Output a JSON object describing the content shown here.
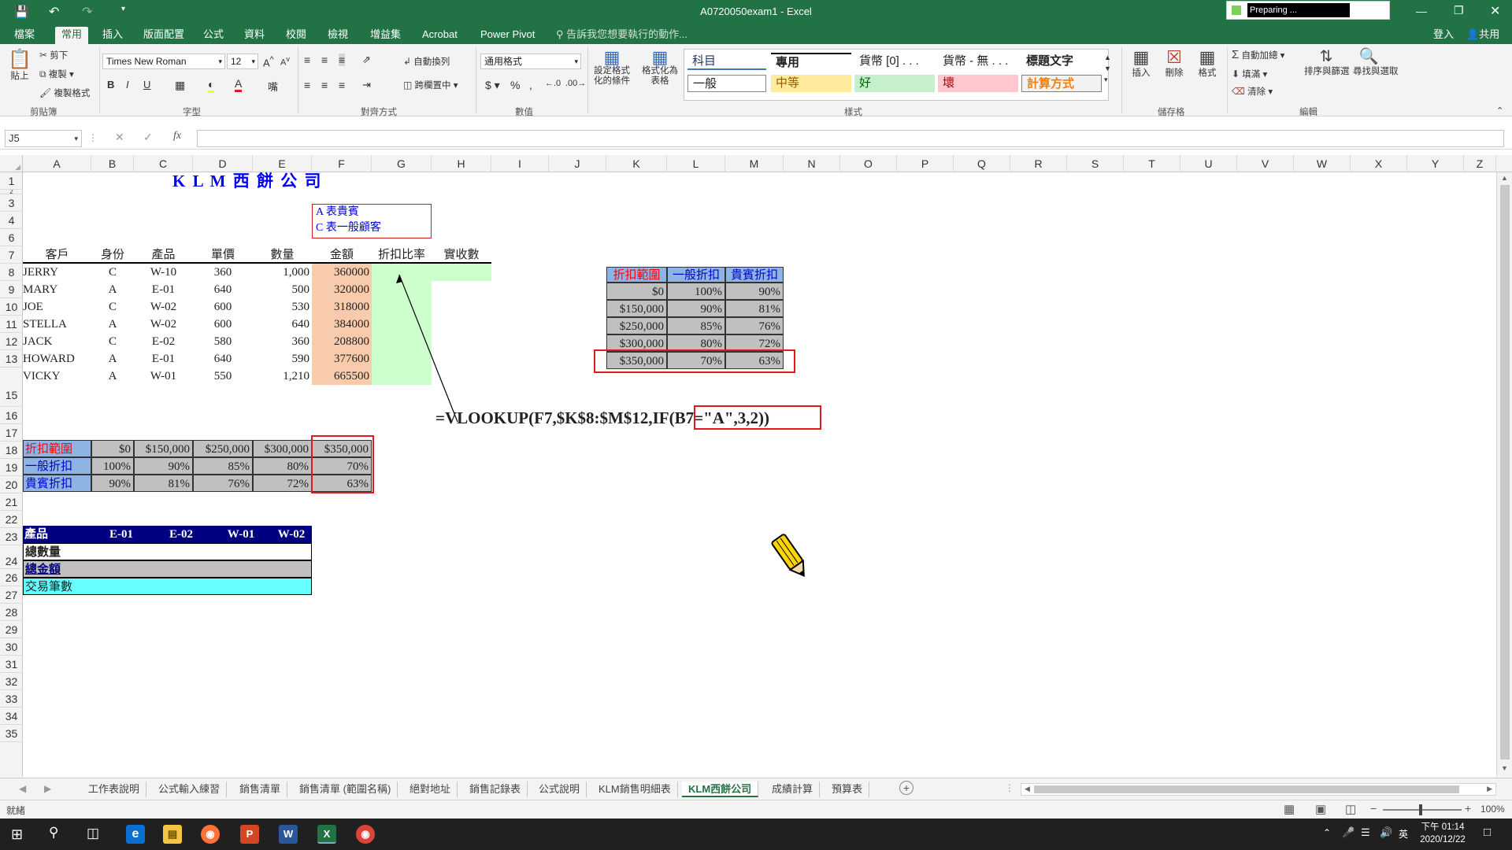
{
  "window": {
    "title": "A0720050exam1 - Excel",
    "progress_label": "Preparing ..."
  },
  "qat": {
    "save_icon": "save-icon",
    "undo_icon": "undo-icon",
    "redo_icon": "redo-icon"
  },
  "ribbon_tabs": [
    "檔案",
    "常用",
    "插入",
    "版面配置",
    "公式",
    "資料",
    "校閱",
    "檢視",
    "增益集",
    "Acrobat",
    "Power Pivot"
  ],
  "tell_me": "告訴我您想要執行的動作...",
  "account": {
    "signin": "登入",
    "share": "共用"
  },
  "clipboard": {
    "paste": "貼上",
    "cut": "剪下",
    "copy": "複製",
    "format_painter": "複製格式",
    "group": "剪貼簿"
  },
  "font": {
    "name": "Times New Roman",
    "size": "12",
    "group": "字型"
  },
  "alignment": {
    "wrap": "自動換列",
    "merge": "跨欄置中",
    "group": "對齊方式"
  },
  "number": {
    "format": "通用格式",
    "group": "數值"
  },
  "styles": {
    "cond_format": "設定格式化的條件",
    "as_table": "格式化為表格",
    "items": [
      "科目",
      "專用",
      "貨幣 [0] . . .",
      "貨幣 - 無 . . .",
      "標題文字",
      "一般",
      "中等",
      "好",
      "壞",
      "計算方式"
    ],
    "group": "樣式"
  },
  "cells_group": {
    "insert": "插入",
    "delete": "刪除",
    "format": "格式",
    "group": "儲存格"
  },
  "editing": {
    "autosum": "自動加總",
    "fill": "填滿",
    "clear": "清除",
    "sort": "排序與篩選",
    "find": "尋找與選取",
    "group": "編輯"
  },
  "formula_bar": {
    "name_box": "J5",
    "formula": ""
  },
  "columns": [
    "A",
    "B",
    "C",
    "D",
    "E",
    "F",
    "G",
    "H",
    "I",
    "J",
    "K",
    "L",
    "M",
    "N",
    "O",
    "P",
    "Q",
    "R",
    "S",
    "T",
    "U",
    "V",
    "W",
    "X",
    "Y",
    "Z"
  ],
  "rows": [
    "1",
    "2",
    "3",
    "4",
    "6",
    "7",
    "8",
    "9",
    "10",
    "11",
    "12",
    "13",
    "15",
    "16",
    "17",
    "18",
    "19",
    "20",
    "21",
    "22",
    "23",
    "24",
    "26",
    "27",
    "28",
    "29",
    "30",
    "31",
    "32",
    "33",
    "34",
    "35"
  ],
  "sheet": {
    "title": "K L M 西 餅 公 司",
    "legend": [
      "A  表貴賓",
      "C  表一般顧客"
    ],
    "headers": [
      "客戶",
      "身份",
      "產品",
      "單價",
      "數量",
      "金額",
      "折扣比率",
      "實收數"
    ],
    "customers": [
      {
        "name": "JERRY",
        "id": "C",
        "product": "W-10",
        "price": "360",
        "qty": "1,000",
        "amount": "360000"
      },
      {
        "name": "MARY",
        "id": "A",
        "product": "E-01",
        "price": "640",
        "qty": "500",
        "amount": "320000"
      },
      {
        "name": "JOE",
        "id": "C",
        "product": "W-02",
        "price": "600",
        "qty": "530",
        "amount": "318000"
      },
      {
        "name": "STELLA",
        "id": "A",
        "product": "W-02",
        "price": "600",
        "qty": "640",
        "amount": "384000"
      },
      {
        "name": "JACK",
        "id": "C",
        "product": "E-02",
        "price": "580",
        "qty": "360",
        "amount": "208800"
      },
      {
        "name": "HOWARD",
        "id": "A",
        "product": "E-01",
        "price": "640",
        "qty": "590",
        "amount": "377600"
      },
      {
        "name": "VICKY",
        "id": "A",
        "product": "W-01",
        "price": "550",
        "qty": "1,210",
        "amount": "665500"
      }
    ],
    "formula_annotation": "=VLOOKUP(F7,$K$8:$M$12,IF(B7=\"A\",3,2))",
    "discount_table": {
      "headers": [
        "折扣範圍",
        "一般折扣",
        "貴賓折扣"
      ],
      "rows": [
        [
          "$0",
          "100%",
          "90%"
        ],
        [
          "$150,000",
          "90%",
          "81%"
        ],
        [
          "$250,000",
          "85%",
          "76%"
        ],
        [
          "$300,000",
          "80%",
          "72%"
        ],
        [
          "$350,000",
          "70%",
          "63%"
        ]
      ]
    },
    "h_table": {
      "rows": [
        [
          "折扣範圍",
          "$0",
          "$150,000",
          "$250,000",
          "$300,000",
          "$350,000"
        ],
        [
          "一般折扣",
          "100%",
          "90%",
          "85%",
          "80%",
          "70%"
        ],
        [
          "貴賓折扣",
          "90%",
          "81%",
          "76%",
          "72%",
          "63%"
        ]
      ]
    },
    "product_table": {
      "header": [
        "產品",
        "E-01",
        "E-02",
        "W-01",
        "W-02"
      ],
      "labels": [
        "總數量",
        "總金額",
        "交易筆數"
      ]
    }
  },
  "sheet_tabs": [
    "工作表說明",
    "公式輸入練習",
    "銷售清單",
    "銷售清單 (範圍名稱)",
    "絕對地址",
    "銷售記錄表",
    "公式說明",
    "KLM銷售明細表",
    "KLM西餅公司",
    "成績計算",
    "預算表"
  ],
  "active_sheet": "KLM西餅公司",
  "status": {
    "ready": "就緒",
    "zoom": "100%"
  },
  "taskbar": {
    "time": "下午 01:14",
    "date": "2020/12/22",
    "ime": "英"
  },
  "colors": {
    "excel_green": "#217346",
    "amount_fill": "#f8cbad",
    "discount_fill": "#ccffcc",
    "table_gray": "#c0c0c0",
    "header_blue": "#8eb4e3",
    "product_header": "#000080",
    "cyan_row": "#66ffff",
    "highlight_red": "#e0191c"
  }
}
